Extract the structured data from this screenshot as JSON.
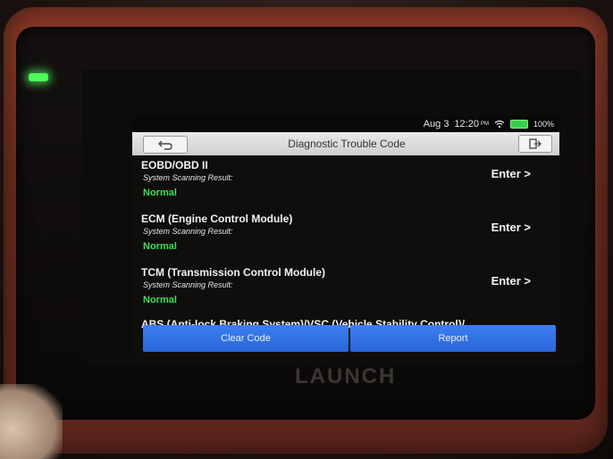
{
  "device": {
    "brand": "LAUNCH"
  },
  "status_bar": {
    "date": "Aug 3",
    "time": "12:20",
    "ampm": "PM",
    "battery": "100%",
    "battery_color": "#35d04a"
  },
  "header": {
    "title": "Diagnostic Trouble Code",
    "back_icon": "back-arrow-icon",
    "exit_icon": "exit-icon"
  },
  "systems": [
    {
      "name": "EOBD/OBD II",
      "subtitle": "System Scanning Result:",
      "result": "Normal",
      "action": "Enter >"
    },
    {
      "name": "ECM (Engine Control Module)",
      "subtitle": "System Scanning Result:",
      "result": "Normal",
      "action": "Enter >"
    },
    {
      "name": "TCM (Transmission Control Module)",
      "subtitle": "System Scanning Result:",
      "result": "Normal",
      "action": "Enter >"
    },
    {
      "name": "ABS (Anti-lock Braking System)/VSC (Vehicle Stability Control)/"
    }
  ],
  "footer": {
    "clear_code_label": "Clear Code",
    "report_label": "Report",
    "button_color": "#2f72e6"
  },
  "colors": {
    "normal_status": "#38e05a",
    "casing": "#7a3224",
    "led": "#4cff5a"
  }
}
